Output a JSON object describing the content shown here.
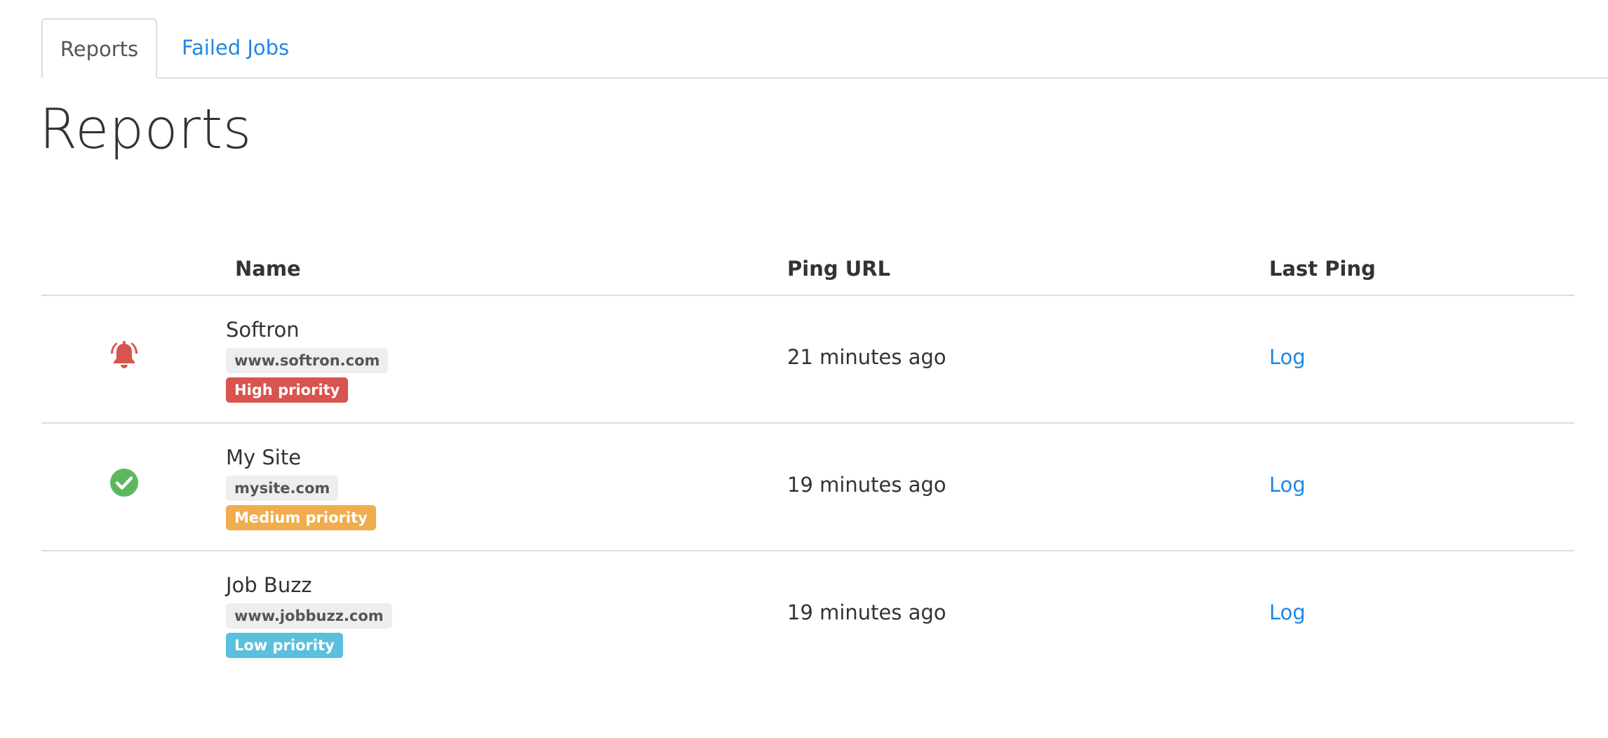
{
  "tabs": [
    {
      "label": "Reports",
      "active": true
    },
    {
      "label": "Failed Jobs",
      "active": false
    }
  ],
  "page_title": "Reports",
  "table": {
    "headers": {
      "name": "Name",
      "ping_url": "Ping URL",
      "last_ping": "Last Ping"
    },
    "rows": [
      {
        "status_icon": "bell-icon",
        "status_color": "#d9534f",
        "name": "Softron",
        "url": "www.softron.com",
        "priority": "High priority",
        "priority_color": "#d9534f",
        "ping": "21 minutes ago",
        "log": "Log"
      },
      {
        "status_icon": "check-circle-icon",
        "status_color": "#5cb85c",
        "name": "My Site",
        "url": "mysite.com",
        "priority": "Medium priority",
        "priority_color": "#f0ad4e",
        "ping": "19 minutes ago",
        "log": "Log"
      },
      {
        "status_icon": "",
        "status_color": "",
        "name": "Job Buzz",
        "url": "www.jobbuzz.com",
        "priority": "Low priority",
        "priority_color": "#5bc0de",
        "ping": "19 minutes ago",
        "log": "Log"
      }
    ]
  },
  "colors": {
    "link": "#1e88e5",
    "border": "#dddddd",
    "text": "#333333"
  }
}
